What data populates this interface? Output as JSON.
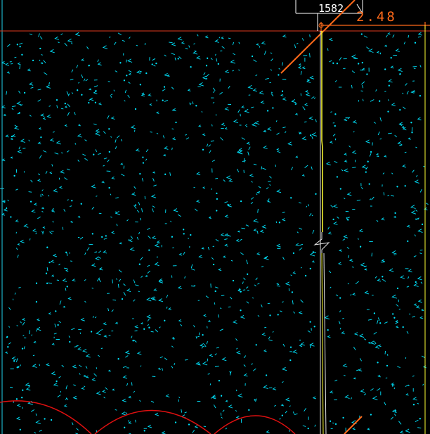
{
  "drawing": {
    "dimension_width_label": "1582",
    "dimension_offset_label": "2.48",
    "colors": {
      "background": "#000000",
      "hatch": "#00e5ff",
      "reference_line": "#e03a1e",
      "dimension_orange": "#ff6a1a",
      "centerline_yellow": "#ffff33",
      "wall_white": "#e8e8e8",
      "arc_red": "#e01010",
      "border_cyan": "#22d3ee"
    },
    "layers": {
      "hatch": "concrete-hatch-pattern",
      "dimension": "dimension-lines",
      "centerline": "break-line",
      "reference": "reference-line",
      "arcs": "pile-arcs"
    }
  }
}
